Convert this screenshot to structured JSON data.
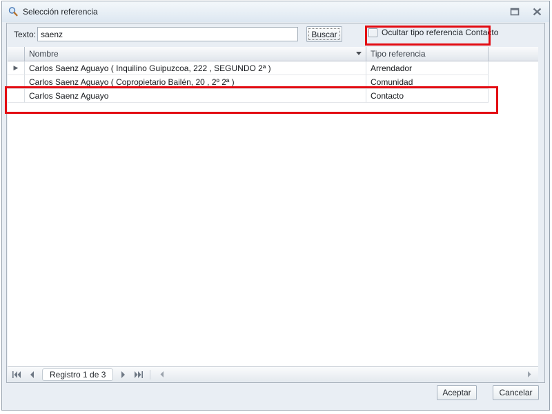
{
  "window": {
    "title": "Selección referencia"
  },
  "toolbar": {
    "text_label": "Texto:",
    "text_value": "saenz",
    "search_button": "Buscar",
    "checkbox_label": "Ocultar tipo referencia Contacto",
    "checkbox_checked": false
  },
  "grid": {
    "columns": [
      "Nombre",
      "Tipo referencia"
    ],
    "rows": [
      {
        "nombre": "Carlos Saenz Aguayo ( Inquilino Guipuzcoa, 222 , SEGUNDO 2ª )",
        "tipo": "Arrendador"
      },
      {
        "nombre": "Carlos Saenz Aguayo ( Copropietario Bailén, 20 , 2º 2ª )",
        "tipo": "Comunidad"
      },
      {
        "nombre": "Carlos Saenz Aguayo",
        "tipo": "Contacto"
      }
    ]
  },
  "pager": {
    "record_label": "Registro 1 de 3"
  },
  "footer": {
    "accept_button": "Aceptar",
    "cancel_button": "Cancelar"
  },
  "colors": {
    "annotation_red": "#e30b12"
  }
}
